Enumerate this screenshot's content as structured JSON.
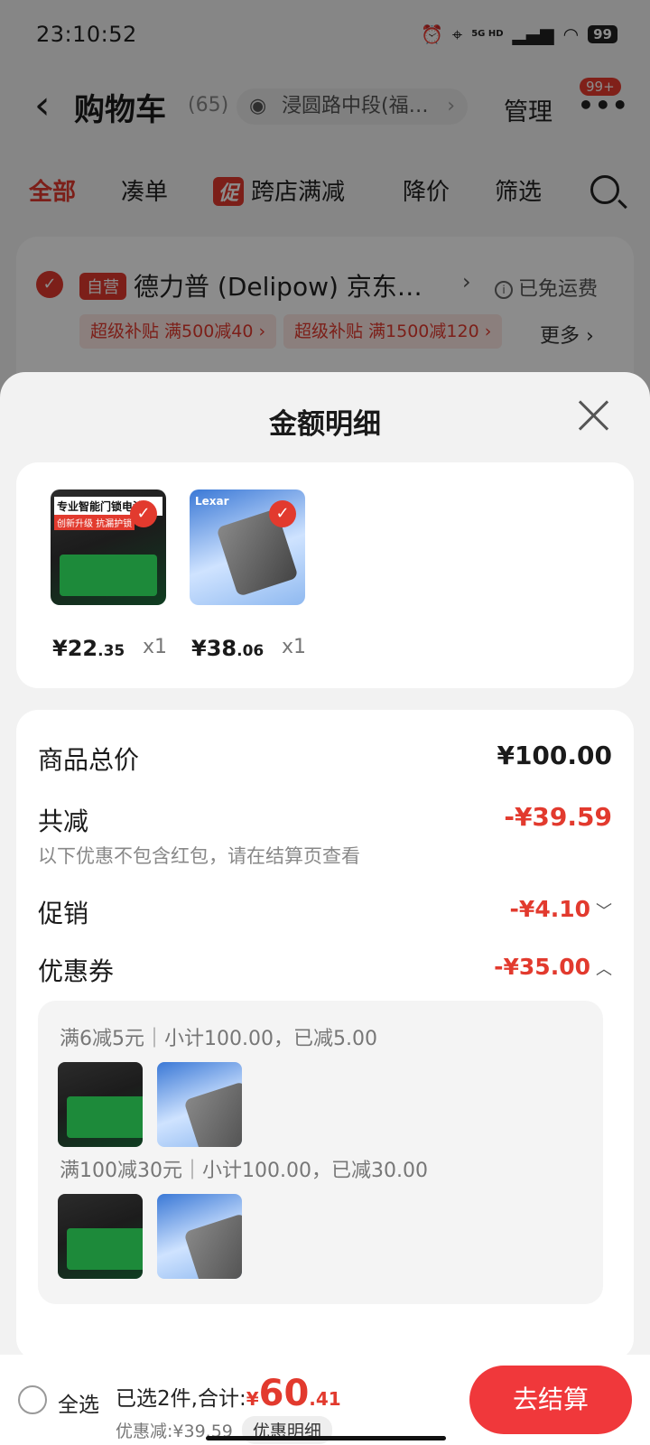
{
  "status_bar": {
    "time": "23:10:52",
    "network": "5G HD",
    "battery": "99"
  },
  "header": {
    "back_icon": "chevron-left-icon",
    "title": "购物车",
    "count": "(65)",
    "address": "浸圆路中段(福…",
    "manage": "管理",
    "more_badge": "99+"
  },
  "tabs": [
    {
      "label": "全部"
    },
    {
      "label": "凑单"
    },
    {
      "label": "跨店满减",
      "tag": "促"
    },
    {
      "label": "降价"
    },
    {
      "label": "筛选"
    }
  ],
  "store": {
    "self_tag": "自营",
    "name": "德力普 (Delipow) 京东…",
    "shipping": "已免运费",
    "promos": [
      "超级补贴  满500减40 ›",
      "超级补贴  满1500减120 ›"
    ],
    "more": "更多 ›"
  },
  "sheet": {
    "title": "金额明细",
    "products": [
      {
        "name_img": "专业智能门锁电池",
        "img_tag": "创新升级 抗漏护锁",
        "price_int": "¥22",
        "price_dec": ".35",
        "qty": "x1"
      },
      {
        "name_img": "Lexar",
        "price_int": "¥38",
        "price_dec": ".06",
        "qty": "x1"
      }
    ],
    "total_label": "商品总价",
    "total_value": "¥100.00",
    "reduce_label": "共减",
    "reduce_value": "-¥39.59",
    "reduce_note": "以下优惠不包含红包，请在结算页查看",
    "promo_label": "促销",
    "promo_value": "-¥4.10",
    "coupon_label": "优惠券",
    "coupon_value": "-¥35.00",
    "coupon_rules": [
      "满6减5元｜小计100.00，已减5.00",
      "满100减30元｜小计100.00，已减30.00"
    ]
  },
  "footer": {
    "select_all": "全选",
    "selected_text": "已选2件,合计:",
    "total_yen": "¥",
    "total_int": "60",
    "total_dec": ".41",
    "discount_text": "优惠减:¥39.59",
    "discount_detail": "优惠明细",
    "checkout": "去结算"
  },
  "colors": {
    "accent": "#e23a2e",
    "checkout": "#f0383b"
  }
}
